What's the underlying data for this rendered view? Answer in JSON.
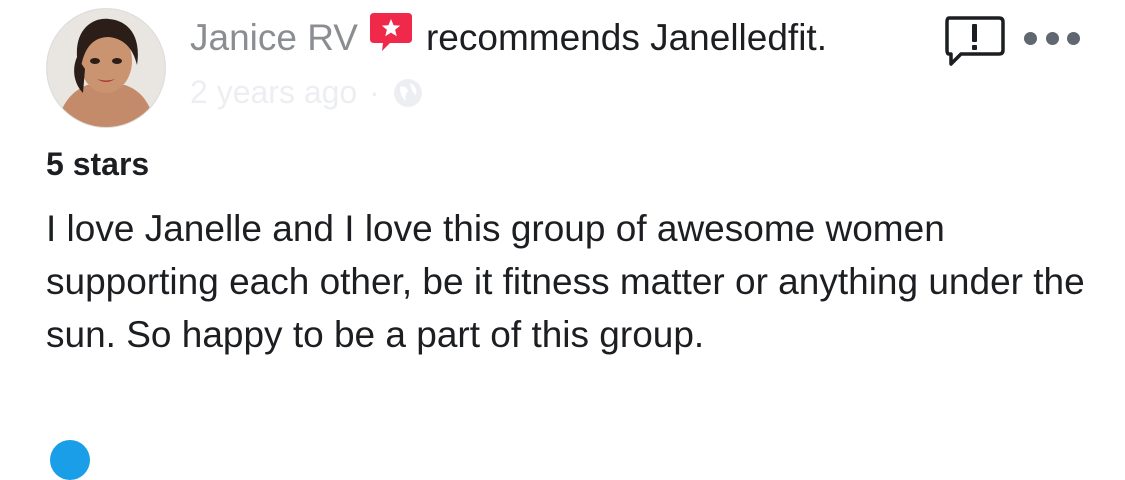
{
  "post": {
    "author": "Janice RV",
    "verb": "recommends Janelledfit.",
    "timestamp": "2 years ago",
    "separator": "·",
    "privacy_icon": "globe-icon",
    "rating": "5 stars",
    "review": "I love Janelle and I love this group of awesome women supporting each other, be it fitness matter or anything under the sun. So happy to be a part of this group."
  },
  "icons": {
    "recommend_badge": "recommend-star-icon",
    "report": "report-exclamation-icon",
    "more": "more-options-icon"
  },
  "colors": {
    "author": "#8a8d91",
    "badge": "#f0284a",
    "text": "#1c1e21",
    "next_avatar": "#1a9ee8"
  }
}
